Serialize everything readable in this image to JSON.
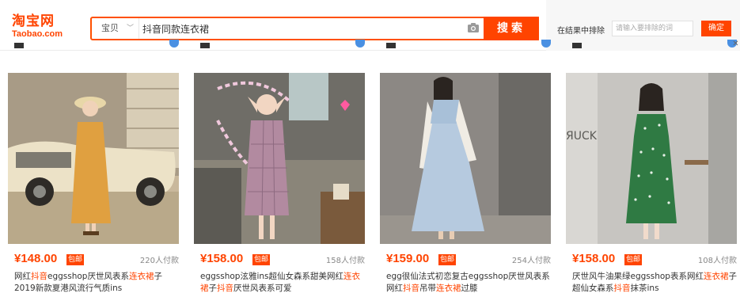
{
  "header": {
    "logo_cn": "淘宝网",
    "logo_en": "Taobao.com",
    "search": {
      "category": "宝贝",
      "query": "抖音同款连衣裙",
      "button": "搜索"
    },
    "exclude": {
      "label": "在结果中排除",
      "placeholder": "请输入要排除的词",
      "button": "确定"
    }
  },
  "products": [
    {
      "price": "¥148.00",
      "badge": "包邮",
      "sold": "220人付款",
      "title_parts": [
        "网红",
        "抖音",
        "eggsshop厌世风表系",
        "连衣裙",
        "子2019新款夏港风流行气质ins"
      ]
    },
    {
      "price": "¥158.00",
      "badge": "包邮",
      "sold": "158人付款",
      "title_parts": [
        "eggsshop泫雅ins超仙女森系甜美网红",
        "连衣",
        "裙",
        "子",
        "抖音",
        "厌世风表系可爱"
      ]
    },
    {
      "price": "¥159.00",
      "badge": "包邮",
      "sold": "254人付款",
      "title_parts": [
        "egg很仙法式初恋复古eggsshop厌世风表系网红",
        "抖音",
        "吊带",
        "连衣裙",
        "过膝"
      ]
    },
    {
      "price": "¥158.00",
      "badge": "包邮",
      "sold": "108人付款",
      "title_parts": [
        "厌世风牛油果绿eggsshop表系网红",
        "连衣裙",
        "子超仙女森系",
        "抖音",
        "抹茶ins"
      ]
    }
  ],
  "colors": {
    "accent": "#ff4400",
    "text": "#333333",
    "muted": "#888888"
  },
  "icons": [
    "camera-icon",
    "chevron-down-icon",
    "close-icon"
  ]
}
